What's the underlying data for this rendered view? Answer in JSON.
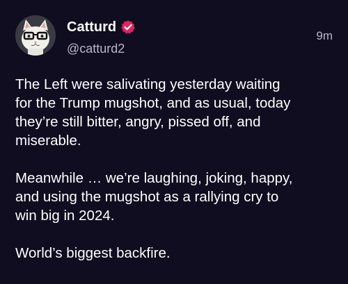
{
  "author": {
    "display_name": "Catturd",
    "handle": "@catturd2",
    "verified_icon": "verified-badge-icon",
    "badge_color": "#e0245e"
  },
  "post": {
    "timestamp": "9m",
    "paragraphs": [
      "The Left were salivating yesterday waiting\nfor the Trump mugshot, and as usual, today\nthey’re still bitter, angry, pissed off, and\nmiserable.",
      "Meanwhile … we’re laughing, joking, happy,\nand using the mugshot as a rallying cry to\nwin big in 2024.",
      "World’s biggest backfire."
    ]
  },
  "colors": {
    "background": "#0f0d1f",
    "text": "#ffffff",
    "secondary_text": "#b9b7c6"
  }
}
